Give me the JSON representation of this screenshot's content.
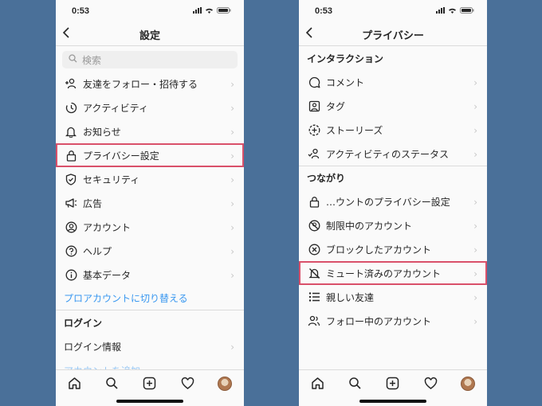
{
  "status": {
    "time": "0:53"
  },
  "left": {
    "title": "設定",
    "search_placeholder": "検索",
    "items": [
      {
        "label": "友達をフォロー・招待する",
        "icon": "add-person-icon"
      },
      {
        "label": "アクティビティ",
        "icon": "activity-clock-icon"
      },
      {
        "label": "お知らせ",
        "icon": "bell-icon"
      },
      {
        "label": "プライバシー設定",
        "icon": "lock-icon"
      },
      {
        "label": "セキュリティ",
        "icon": "shield-icon"
      },
      {
        "label": "広告",
        "icon": "megaphone-icon"
      },
      {
        "label": "アカウント",
        "icon": "account-circle-icon"
      },
      {
        "label": "ヘルプ",
        "icon": "help-icon"
      },
      {
        "label": "基本データ",
        "icon": "info-icon"
      }
    ],
    "pro_link": "プロアカウントに切り替える",
    "login_section": "ログイン",
    "login_info": "ログイン情報",
    "add_account": "アカウントを追加"
  },
  "right": {
    "title": "プライバシー",
    "section1": "インタラクション",
    "interaction_items": [
      {
        "label": "コメント",
        "icon": "comment-icon"
      },
      {
        "label": "タグ",
        "icon": "tag-person-icon"
      },
      {
        "label": "ストーリーズ",
        "icon": "story-plus-icon"
      },
      {
        "label": "アクティビティのステータス",
        "icon": "activity-status-icon"
      }
    ],
    "section2": "つながり",
    "connection_items": [
      {
        "label": "…ウントのプライバシー設定",
        "icon": "lock-icon"
      },
      {
        "label": "制限中のアカウント",
        "icon": "restricted-icon"
      },
      {
        "label": "ブロックしたアカウント",
        "icon": "blocked-icon"
      },
      {
        "label": "ミュート済みのアカウント",
        "icon": "muted-bell-icon"
      },
      {
        "label": "親しい友達",
        "icon": "close-friends-list-icon"
      },
      {
        "label": "フォロー中のアカウント",
        "icon": "following-icon"
      }
    ]
  },
  "colors": {
    "highlight": "#d9506a",
    "link": "#3897f0",
    "background": "#4a7099"
  }
}
